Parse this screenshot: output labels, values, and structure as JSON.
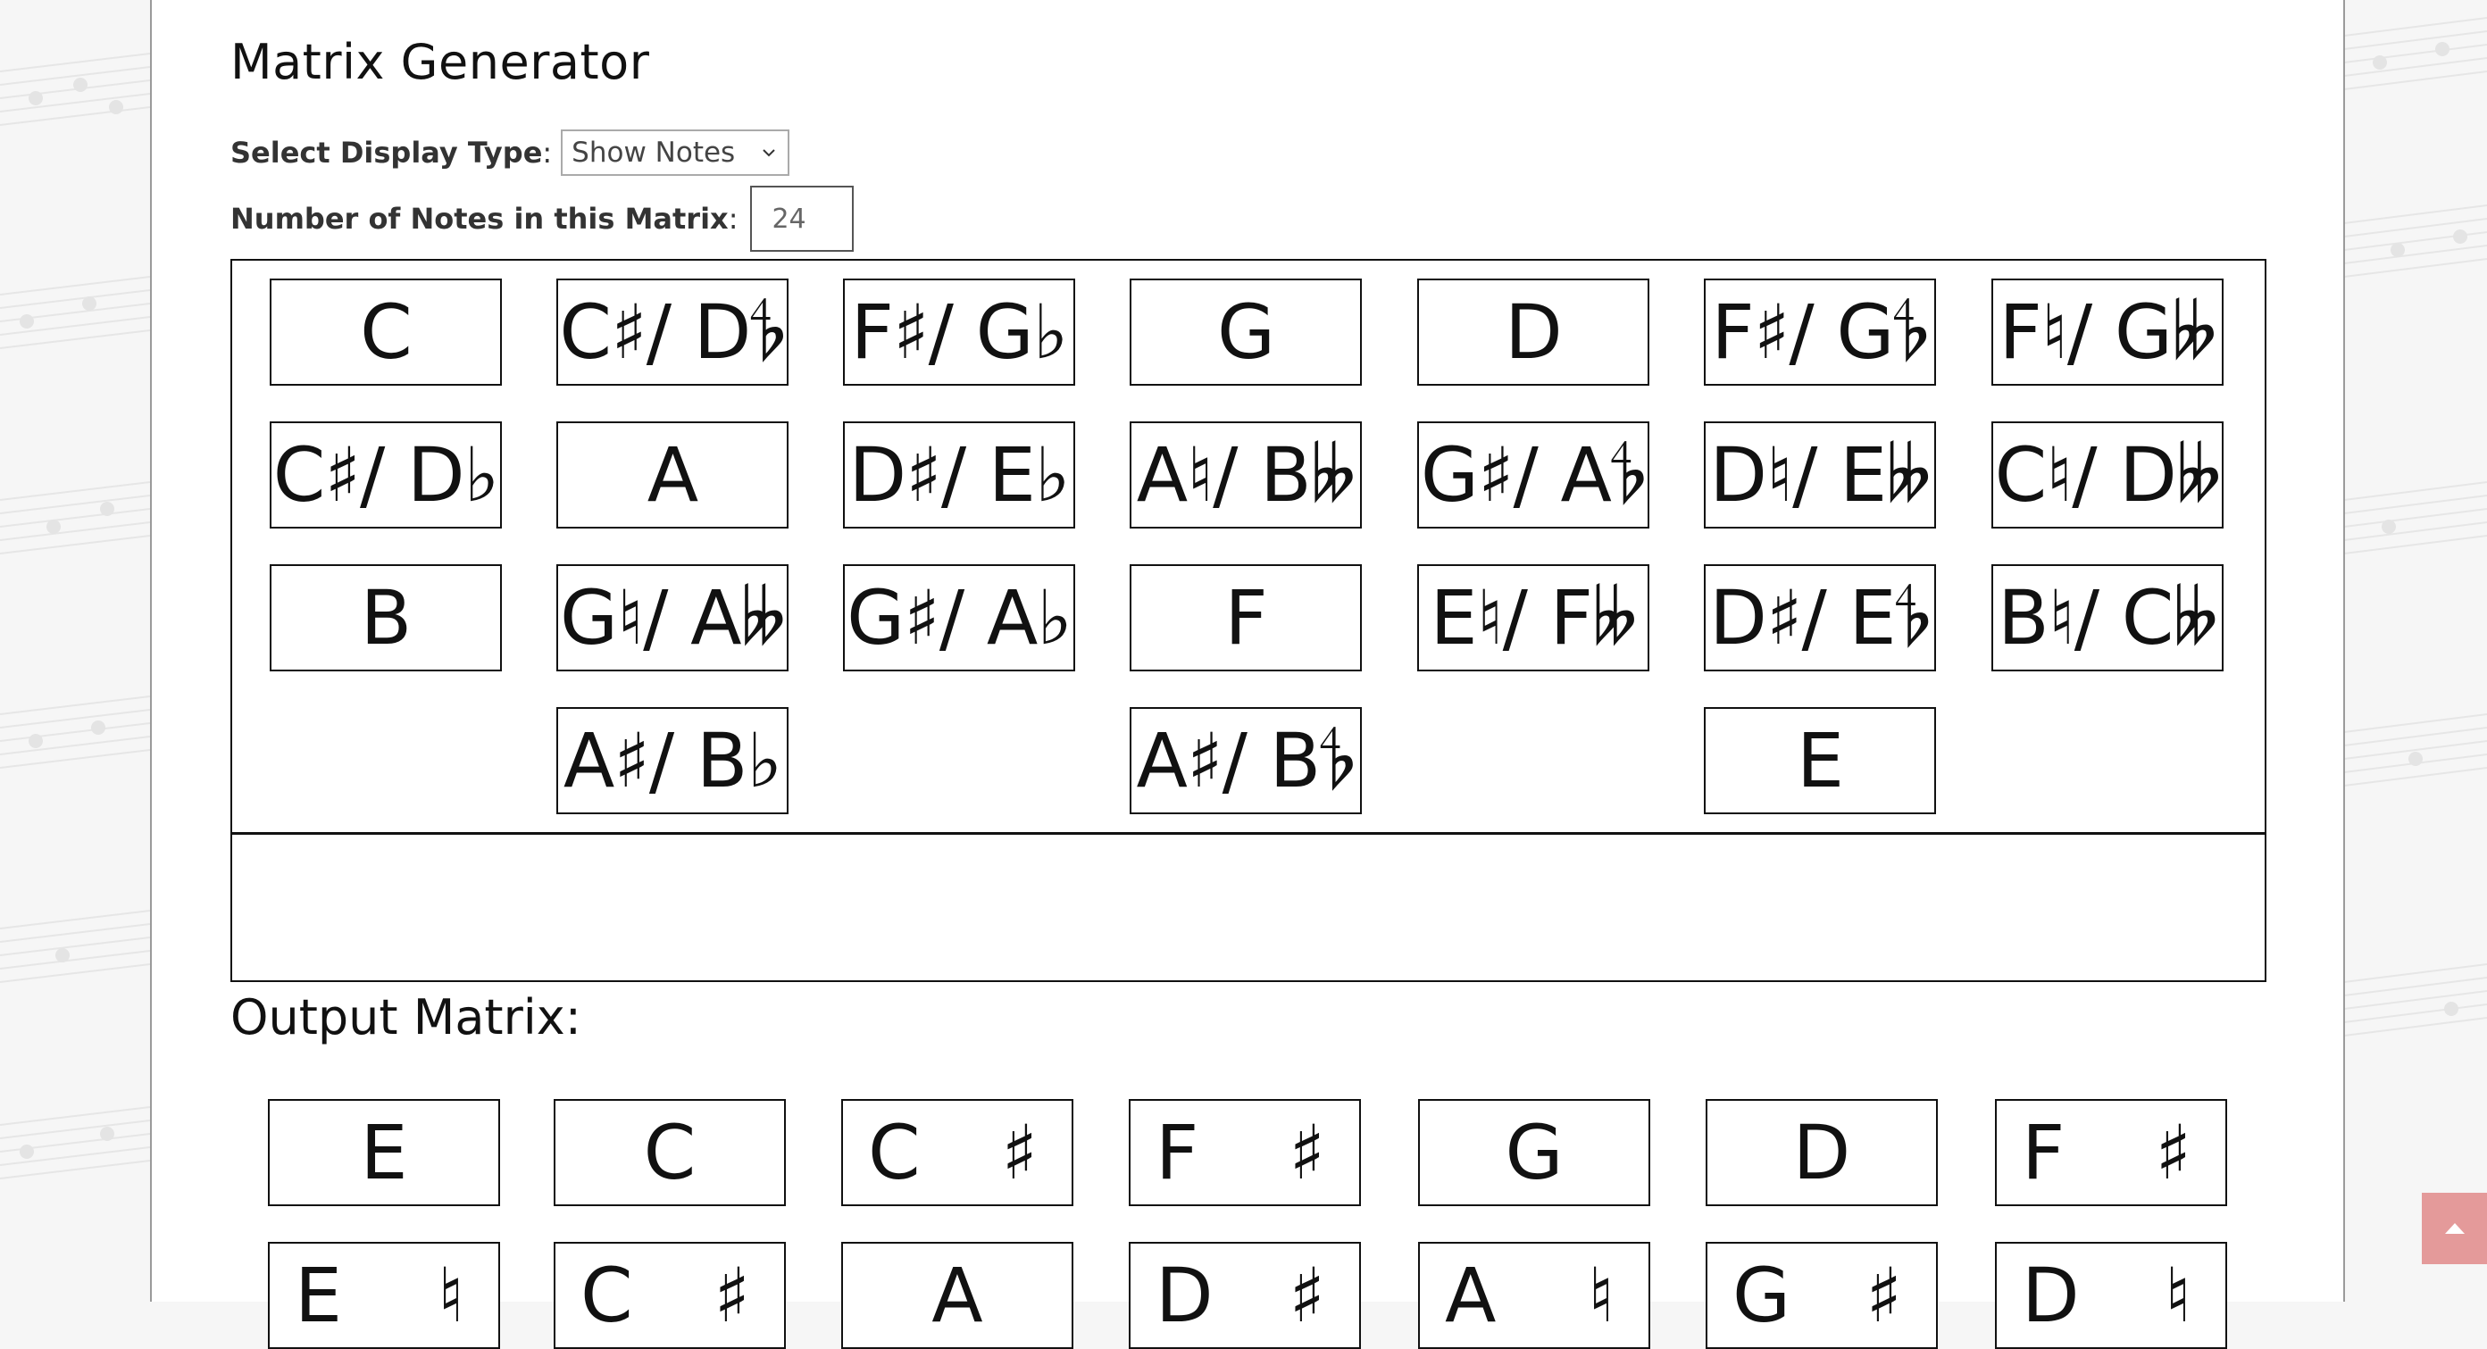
{
  "page": {
    "title": "Matrix Generator"
  },
  "form": {
    "display_type_label": "Select Display Type",
    "display_type_value": "Show Notes",
    "note_count_label": "Number of Notes in this Matrix",
    "note_count_value": "24"
  },
  "input_matrix": {
    "rows": [
      [
        "C",
        "C♯/ D𝄳",
        "F♯/ G♭",
        "G",
        "D",
        "F♯/ G𝄳",
        "F♮/ G𝄫"
      ],
      [
        "C♯/ D♭",
        "A",
        "D♯/ E♭",
        "A♮/ B𝄫",
        "G♯/ A𝄳",
        "D♮/ E𝄫",
        "C♮/ D𝄫"
      ],
      [
        "B",
        "G♮/ A𝄫",
        "G♯/ A♭",
        "F",
        "E♮/ F𝄫",
        "D♯/ E𝄳",
        "B♮/ C𝄫"
      ],
      [
        "",
        "A♯/ B♭",
        "",
        "A♯/ B𝄳",
        "",
        "E",
        ""
      ]
    ]
  },
  "output_matrix": {
    "title": "Output Matrix:",
    "rows": [
      [
        [
          "E",
          ""
        ],
        [
          "C",
          ""
        ],
        [
          "C",
          "♯"
        ],
        [
          "F",
          "♯"
        ],
        [
          "G",
          ""
        ],
        [
          "D",
          ""
        ],
        [
          "F",
          "♯"
        ]
      ],
      [
        [
          "E",
          "♮"
        ],
        [
          "C",
          "♯"
        ],
        [
          "A",
          ""
        ],
        [
          "D",
          "♯"
        ],
        [
          "A",
          "♮"
        ],
        [
          "G",
          "♯"
        ],
        [
          "D",
          "♮"
        ]
      ]
    ]
  },
  "icons": {
    "select_arrow": "chevron-down-icon",
    "scroll_top": "arrow-up-icon"
  },
  "colors": {
    "scroll_button": "#e49a9a",
    "page_background": "#ffffff",
    "side_background": "#f6f6f6"
  }
}
